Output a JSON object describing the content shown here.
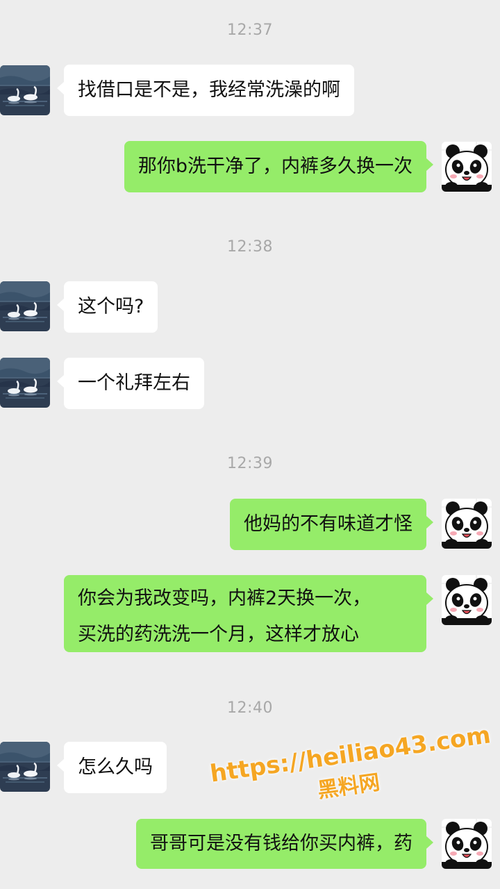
{
  "timestamps": [
    "12:37",
    "12:38",
    "12:39",
    "12:40"
  ],
  "messages": [
    {
      "side": "in",
      "text": "找借口是不是，我经常洗澡的啊"
    },
    {
      "side": "out",
      "text": "那你b洗干净了，内裤多久换一次"
    },
    {
      "side": "in",
      "text": "这个吗?"
    },
    {
      "side": "in",
      "text": "一个礼拜左右"
    },
    {
      "side": "out",
      "text": "他妈的不有味道才怪"
    },
    {
      "side": "out",
      "lines": [
        "你会为我改变吗，内裤2天换一次，",
        "买洗的药洗洗一个月，这样才放心"
      ]
    },
    {
      "side": "in",
      "text": "怎么久吗"
    },
    {
      "side": "out",
      "text": "哥哥可是没有钱给你买内裤，药"
    }
  ],
  "watermark": {
    "url": "https://heiliao43.com",
    "name": "黑料网"
  },
  "colors": {
    "background": "#ededed",
    "outgoing_bubble": "#95ec69",
    "incoming_bubble": "#ffffff",
    "timestamp": "#a8a8a8"
  },
  "icons": {
    "incoming_avatar": "swan-avatar-icon",
    "outgoing_avatar": "panda-avatar-icon"
  }
}
